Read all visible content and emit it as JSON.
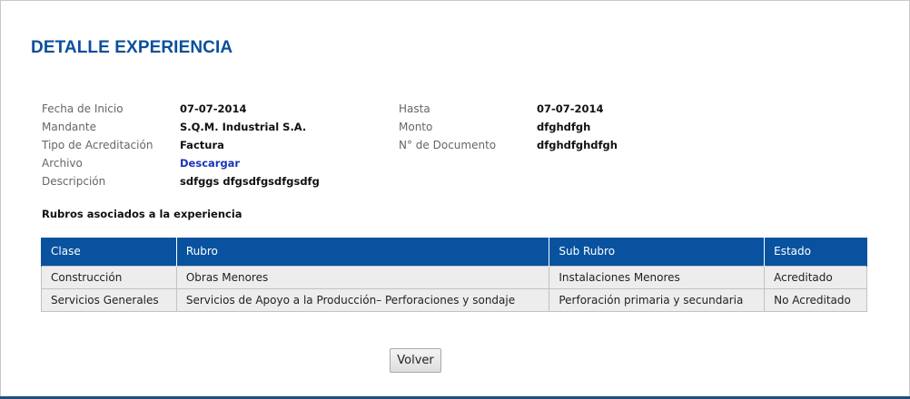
{
  "page": {
    "title": "DETALLE EXPERIENCIA"
  },
  "details": {
    "fecha_inicio_label": "Fecha de Inicio",
    "fecha_inicio_value": "07-07-2014",
    "hasta_label": "Hasta",
    "hasta_value": "07-07-2014",
    "mandante_label": "Mandante",
    "mandante_value": "S.Q.M. Industrial S.A.",
    "monto_label": "Monto",
    "monto_value": "dfghdfgh",
    "tipo_label": "Tipo de Acreditación",
    "tipo_value": "Factura",
    "documento_label": "N° de Documento",
    "documento_value": "dfghdfghdfgh",
    "archivo_label": "Archivo",
    "archivo_link": "Descargar",
    "descripcion_label": "Descripción",
    "descripcion_value": "sdfggs dfgsdfgsdfgsdfg"
  },
  "rubros": {
    "section_title": "Rubros asociados a la experiencia",
    "columns": [
      "Clase",
      "Rubro",
      "Sub Rubro",
      "Estado"
    ],
    "rows": [
      [
        "Construcción",
        "Obras Menores",
        "Instalaciones Menores",
        "Acreditado"
      ],
      [
        "Servicios Generales",
        "Servicios de Apoyo a la Producción– Perforaciones y sondaje",
        "Perforación primaria y secundaria",
        "No Acreditado"
      ]
    ]
  },
  "actions": {
    "volver_label": "Volver"
  },
  "colors": {
    "title": "#0a4f9c",
    "table_header": "#0852a0",
    "row_background": "#ededed",
    "link": "#1a33b8"
  }
}
